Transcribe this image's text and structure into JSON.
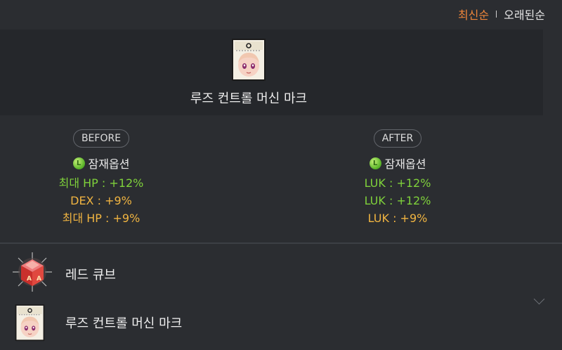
{
  "sort": {
    "newest": "최신순",
    "oldest": "오래된순"
  },
  "item": {
    "name": "루즈 컨트롤 머신 마크"
  },
  "compare": {
    "before_label": "BEFORE",
    "after_label": "AFTER",
    "option_title": "잠재옵션",
    "before_lines": [
      {
        "text": "최대 HP : +12%",
        "color": "#7fd13b"
      },
      {
        "text": "DEX : +9%",
        "color": "#f0b441"
      },
      {
        "text": "최대 HP : +9%",
        "color": "#f0b441"
      }
    ],
    "after_lines": [
      {
        "text": "LUK : +12%",
        "color": "#7fd13b"
      },
      {
        "text": "LUK : +12%",
        "color": "#7fd13b"
      },
      {
        "text": "LUK : +9%",
        "color": "#f0b441"
      }
    ]
  },
  "history": {
    "cube_name": "레드 큐브",
    "item_name": "루즈 컨트롤 머신 마크"
  },
  "icons": {
    "option_badge": "legendary-l-icon",
    "cube": "red-cube-icon",
    "item": "face-accessory-icon",
    "expand": "chevron-down-icon"
  }
}
